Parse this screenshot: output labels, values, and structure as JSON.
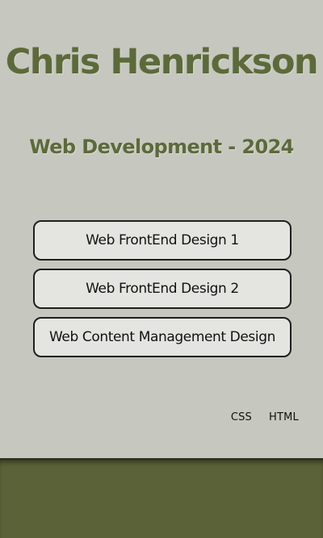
{
  "header": {
    "title": "Chris Henrickson",
    "subtitle": "Web Development - 2024"
  },
  "nav": {
    "items": [
      {
        "label": "Web FrontEnd Design 1"
      },
      {
        "label": "Web FrontEnd Design 2"
      },
      {
        "label": "Web Content Management Design"
      }
    ]
  },
  "footer": {
    "links": [
      {
        "label": "CSS"
      },
      {
        "label": "HTML"
      }
    ]
  },
  "colors": {
    "page_background": "#c6c8bf",
    "title_olive": "#5c6a3a",
    "bottom_band": "#5c6238",
    "button_background": "#e4e4e0",
    "button_border": "#1f1f1f"
  }
}
